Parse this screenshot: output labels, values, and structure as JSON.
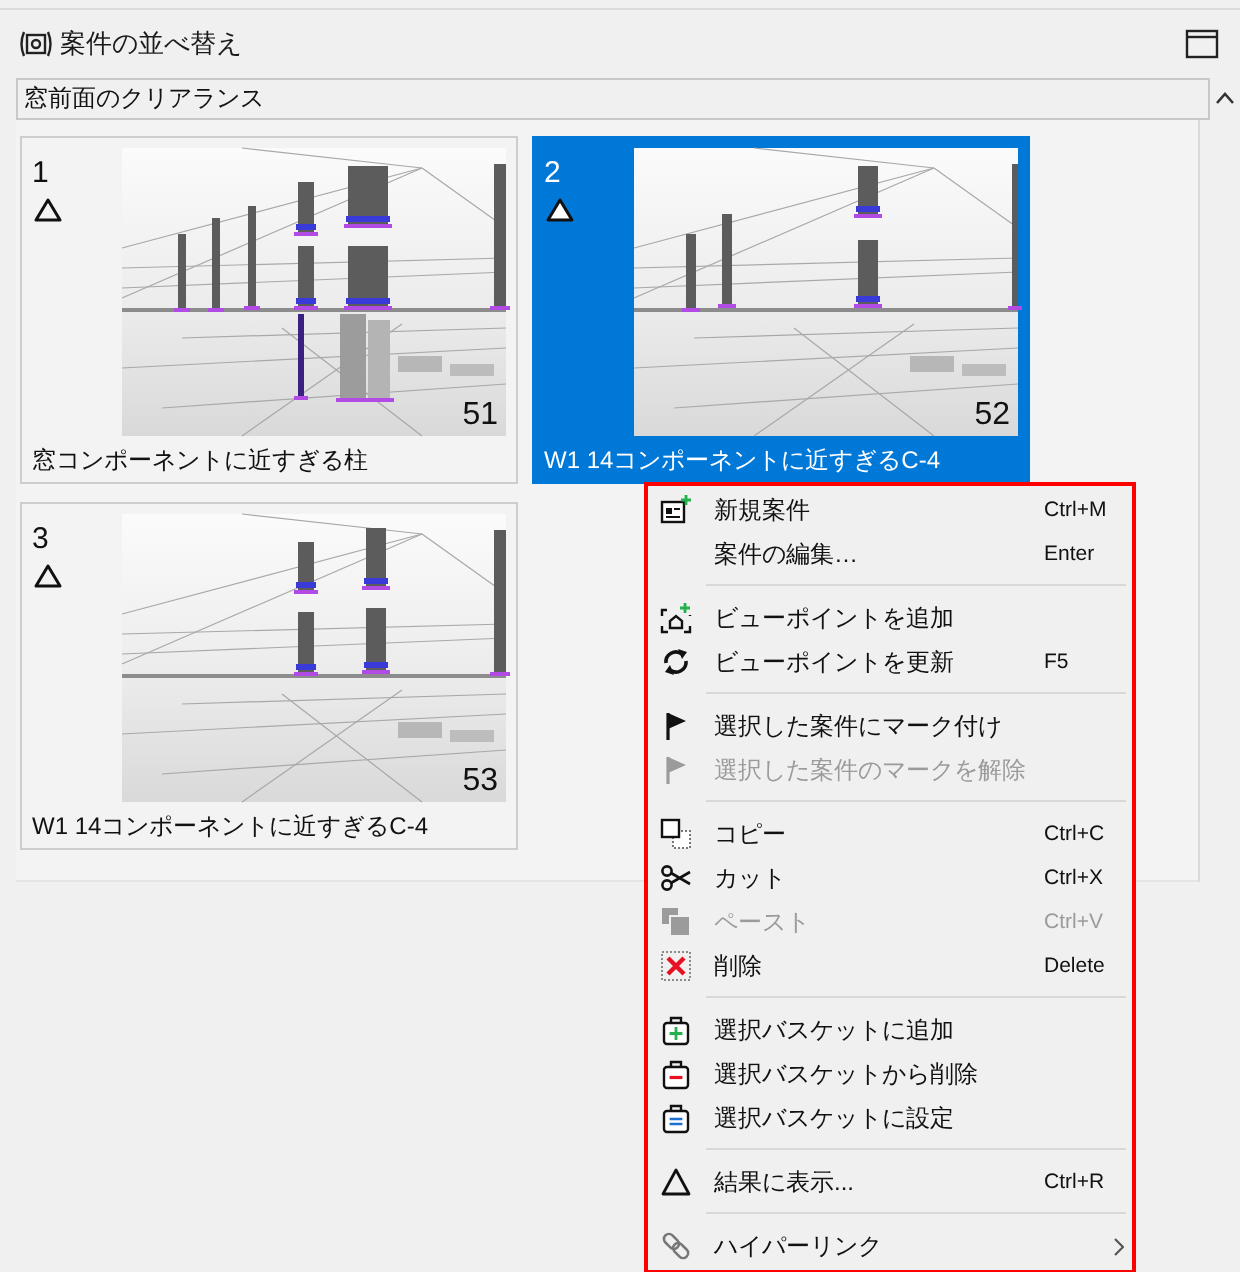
{
  "panel": {
    "title": "案件の並べ替え"
  },
  "group": {
    "title": "窓前面のクリアランス"
  },
  "cards": [
    {
      "number": "1",
      "count": "51",
      "caption": "窓コンポーネントに近すぎる柱",
      "selected": false
    },
    {
      "number": "2",
      "count": "52",
      "caption": "W1 14コンポーネントに近すぎるC-4",
      "selected": true
    },
    {
      "number": "3",
      "count": "53",
      "caption": "W1 14コンポーネントに近すぎるC-4",
      "selected": false
    }
  ],
  "context_menu": {
    "sections": [
      {
        "items": [
          {
            "label": "新規案件",
            "shortcut": "Ctrl+M",
            "disabled": false,
            "submenu": false
          },
          {
            "label": "案件の編集…",
            "shortcut": "Enter",
            "disabled": false,
            "submenu": false
          }
        ]
      },
      {
        "items": [
          {
            "label": "ビューポイントを追加",
            "disabled": false,
            "submenu": false
          },
          {
            "label": "ビューポイントを更新",
            "shortcut": "F5",
            "disabled": false,
            "submenu": false
          }
        ]
      },
      {
        "items": [
          {
            "label": "選択した案件にマーク付け",
            "disabled": false,
            "submenu": false
          },
          {
            "label": "選択した案件のマークを解除",
            "disabled": true,
            "submenu": false
          }
        ]
      },
      {
        "items": [
          {
            "label": "コピー",
            "shortcut": "Ctrl+C",
            "disabled": false,
            "submenu": false
          },
          {
            "label": "カット",
            "shortcut": "Ctrl+X",
            "disabled": false,
            "submenu": false
          },
          {
            "label": "ペースト",
            "shortcut": "Ctrl+V",
            "disabled": true,
            "submenu": false
          },
          {
            "label": "削除",
            "shortcut": "Delete",
            "disabled": false,
            "submenu": false
          }
        ]
      },
      {
        "items": [
          {
            "label": "選択バスケットに追加",
            "disabled": false,
            "submenu": false
          },
          {
            "label": "選択バスケットから削除",
            "disabled": false,
            "submenu": false
          },
          {
            "label": "選択バスケットに設定",
            "disabled": false,
            "submenu": false
          }
        ]
      },
      {
        "items": [
          {
            "label": "結果に表示...",
            "shortcut": "Ctrl+R",
            "disabled": false,
            "submenu": false
          }
        ]
      },
      {
        "items": [
          {
            "label": "ハイパーリンク",
            "disabled": false,
            "submenu": true
          }
        ]
      }
    ]
  }
}
